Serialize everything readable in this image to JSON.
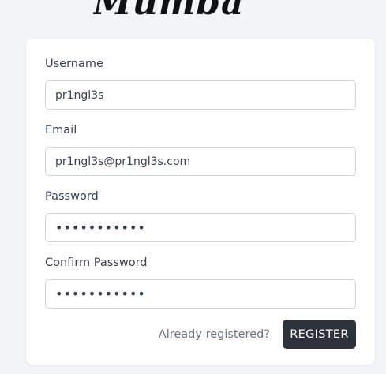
{
  "brand": {
    "logo_text": "Mumba"
  },
  "form": {
    "username": {
      "label": "Username",
      "value": "pr1ngl3s"
    },
    "email": {
      "label": "Email",
      "value": "pr1ngl3s@pr1ngl3s.com"
    },
    "password": {
      "label": "Password",
      "value": "•••••••••••"
    },
    "confirm_password": {
      "label": "Confirm Password",
      "value": "•••••••••••"
    },
    "already_registered_link": "Already registered?",
    "register_button": "REGISTER"
  }
}
